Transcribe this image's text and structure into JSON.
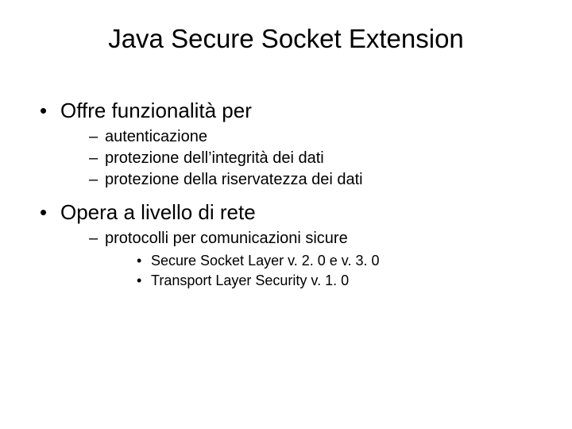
{
  "title": "Java Secure Socket Extension",
  "bullets": [
    {
      "text": "Offre funzionalità per",
      "children": [
        {
          "text": "autenticazione"
        },
        {
          "text": "protezione dell’integrità dei dati"
        },
        {
          "text": "protezione della riservatezza dei dati"
        }
      ]
    },
    {
      "text": "Opera a livello di rete",
      "children": [
        {
          "text": "protocolli per comunicazioni sicure",
          "children": [
            {
              "text": "Secure Socket Layer v. 2. 0 e v. 3. 0"
            },
            {
              "text": "Transport Layer Security v. 1. 0"
            }
          ]
        }
      ]
    }
  ]
}
